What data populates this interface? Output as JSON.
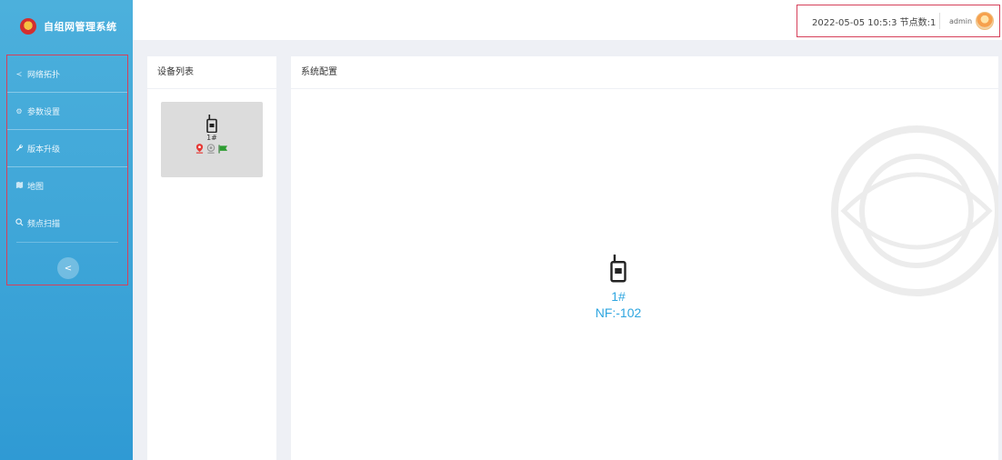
{
  "app": {
    "title": "自组网管理系统"
  },
  "sidebar": {
    "items": [
      {
        "label": "网络拓扑",
        "icon": "share-icon"
      },
      {
        "label": "参数设置",
        "icon": "gear-icon"
      },
      {
        "label": "版本升级",
        "icon": "wrench-icon"
      },
      {
        "label": "地图",
        "icon": "map-icon"
      },
      {
        "label": "频点扫描",
        "icon": "search-icon"
      }
    ],
    "collapse_label": "<"
  },
  "header": {
    "datetime": "2022-05-05 10:5:3",
    "node_count_label": "节点数:1",
    "user": "admin"
  },
  "device_panel": {
    "title": "设备列表",
    "devices": [
      {
        "name": "1#"
      }
    ]
  },
  "config_panel": {
    "title": "系统配置",
    "node": {
      "name": "1#",
      "nf": "NF:-102"
    }
  },
  "colors": {
    "sidebar": "#3fa6d8",
    "accent": "#2fa6e0",
    "highlight_border": "#d6405a"
  }
}
